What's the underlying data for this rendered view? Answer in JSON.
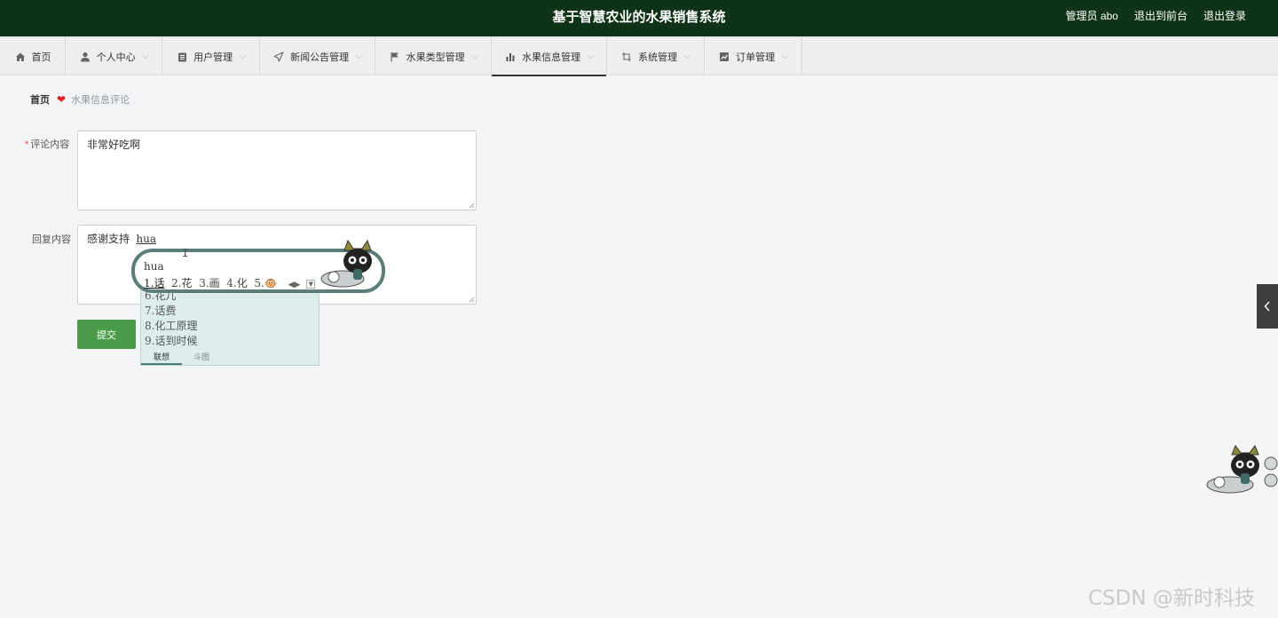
{
  "header": {
    "title": "基于智慧农业的水果销售系统",
    "user": "管理员 abo",
    "to_front": "退出到前台",
    "logout": "退出登录"
  },
  "nav": [
    {
      "label": "首页",
      "icon": "home-icon",
      "has_menu": false
    },
    {
      "label": "个人中心",
      "icon": "user-icon",
      "has_menu": true
    },
    {
      "label": "用户管理",
      "icon": "clipboard-icon",
      "has_menu": true
    },
    {
      "label": "新闻公告管理",
      "icon": "send-icon",
      "has_menu": true
    },
    {
      "label": "水果类型管理",
      "icon": "flag-icon",
      "has_menu": true
    },
    {
      "label": "水果信息管理",
      "icon": "bar-chart-icon",
      "has_menu": true,
      "active": true
    },
    {
      "label": "系统管理",
      "icon": "crop-icon",
      "has_menu": true
    },
    {
      "label": "订单管理",
      "icon": "trend-icon",
      "has_menu": true
    }
  ],
  "breadcrumb": {
    "home": "首页",
    "current": "水果信息评论"
  },
  "form": {
    "comment_label": "评论内容",
    "comment_required": "*",
    "comment_value": "非常好吃啊",
    "reply_label": "回复内容",
    "reply_value": "感谢支持",
    "reply_composing": "hua",
    "submit": "提交"
  },
  "ime": {
    "composition": "hua",
    "candidates": [
      "1.话",
      "2.花",
      "3.画",
      "4.化",
      "5.🐵"
    ],
    "list": [
      "6.花儿",
      "7.话费",
      "8.化工原理",
      "9.话到时候"
    ],
    "tabs": [
      "联想",
      "斗图"
    ]
  },
  "watermark": "CSDN @新时科技",
  "colors": {
    "header_bg": "#0f3318",
    "submit_bg": "#4a9b4a",
    "heart": "#e61b1b",
    "ime_border": "#5a7f7a"
  }
}
